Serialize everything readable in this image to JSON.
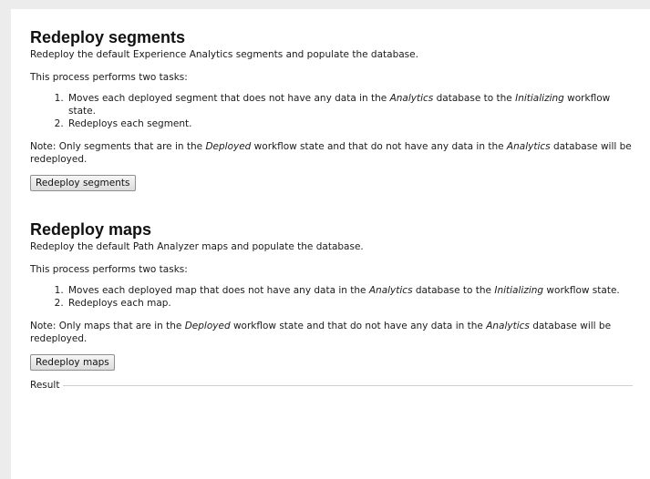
{
  "segments": {
    "title": "Redeploy segments",
    "subtitle": "Redeploy the default Experience Analytics segments and populate the database.",
    "intro": "This process performs two tasks:",
    "task1_a": "Moves each deployed segment that does not have any data in the ",
    "task1_db": "Analytics",
    "task1_b": " database to the ",
    "task1_state": "Initializing",
    "task1_c": " workflow state.",
    "task2": "Redeploys each segment.",
    "note_a": "Note: Only segments that are in the ",
    "note_state": "Deployed",
    "note_b": " workflow state and that do not have any data in the ",
    "note_db": "Analytics",
    "note_c": " database will be redeployed.",
    "button_label": "Redeploy segments"
  },
  "maps": {
    "title": "Redeploy maps",
    "subtitle": "Redeploy the default Path Analyzer maps and populate the database.",
    "intro": "This process performs two tasks:",
    "task1_a": "Moves each deployed map that does not have any data in the ",
    "task1_db": "Analytics",
    "task1_b": " database to the ",
    "task1_state": "Initializing",
    "task1_c": " workflow state.",
    "task2": "Redeploys each map.",
    "note_a": "Note: Only maps that are in the ",
    "note_state": "Deployed",
    "note_b": " workflow state and that do not have any data in the ",
    "note_db": "Analytics",
    "note_c": " database will be redeployed.",
    "button_label": "Redeploy maps"
  },
  "result": {
    "label": "Result"
  }
}
